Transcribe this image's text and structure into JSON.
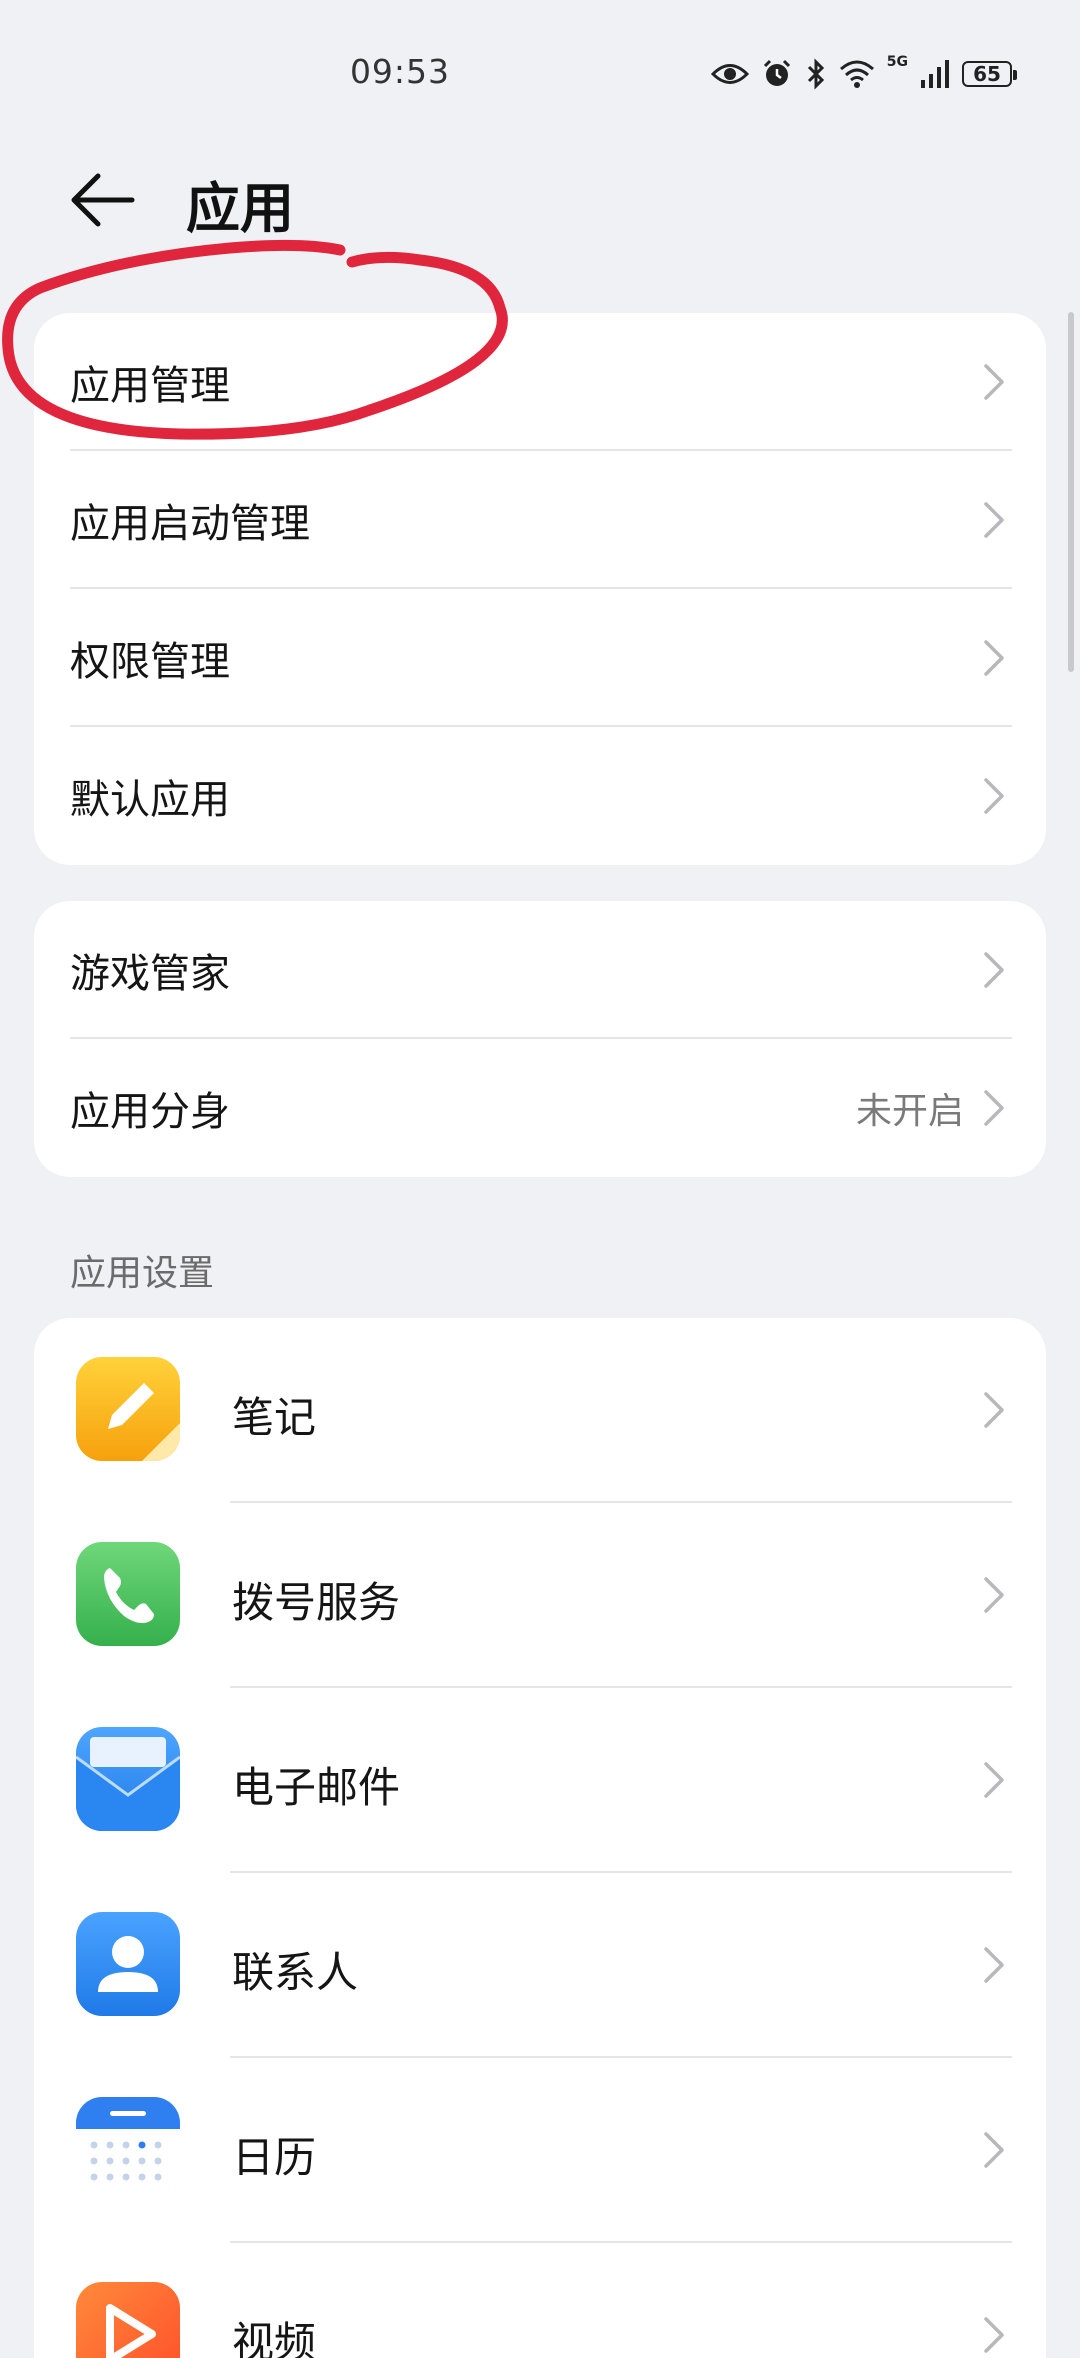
{
  "status": {
    "time": "09:53",
    "net": "5G",
    "battery": "65",
    "icons": [
      "eye-icon",
      "alarm-icon",
      "bluetooth-icon",
      "wifi-icon",
      "signal-icon",
      "battery-icon"
    ]
  },
  "header": {
    "title": "应用"
  },
  "group1": [
    {
      "label": "应用管理"
    },
    {
      "label": "应用启动管理"
    },
    {
      "label": "权限管理"
    },
    {
      "label": "默认应用"
    }
  ],
  "group2": [
    {
      "label": "游戏管家"
    },
    {
      "label": "应用分身",
      "value": "未开启"
    }
  ],
  "section": {
    "title": "应用设置"
  },
  "apps": [
    {
      "label": "笔记",
      "icon": "notes-icon",
      "color": "#f9b21c"
    },
    {
      "label": "拨号服务",
      "icon": "phone-icon",
      "color": "#46c05c"
    },
    {
      "label": "电子邮件",
      "icon": "email-icon",
      "color": "#2f8df2"
    },
    {
      "label": "联系人",
      "icon": "contacts-icon",
      "color": "#2f8df2"
    },
    {
      "label": "日历",
      "icon": "calendar-icon",
      "color": "#2f7ff0"
    },
    {
      "label": "视频",
      "icon": "video-icon",
      "color": "#ff6a2a"
    }
  ],
  "annotation_color": "#e0263c"
}
